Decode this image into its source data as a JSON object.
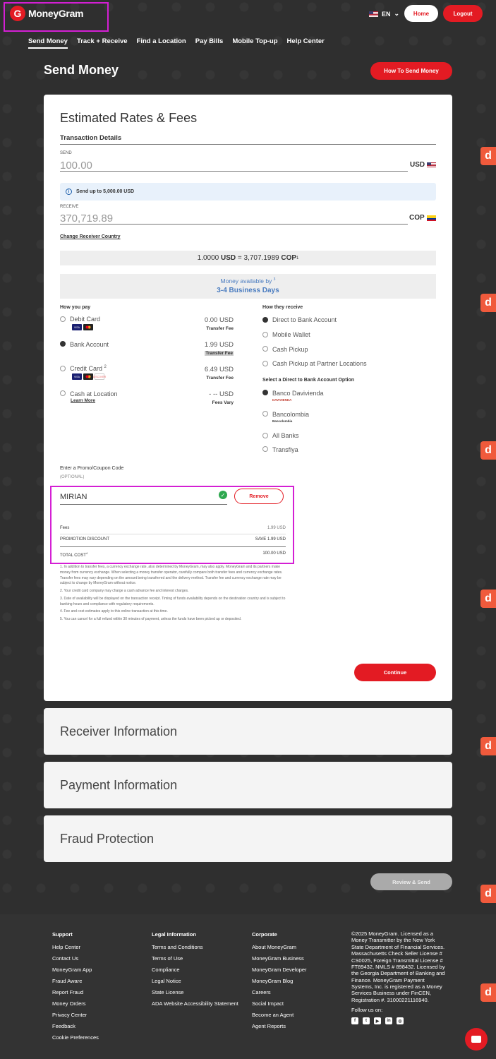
{
  "header": {
    "brand": "MoneyGram",
    "logo_glyph": "G",
    "language": "EN",
    "home_label": "Home",
    "logout_label": "Logout"
  },
  "nav": [
    "Send Money",
    "Track + Receive",
    "Find a Location",
    "Pay Bills",
    "Mobile Top-up",
    "Help Center"
  ],
  "page": {
    "title": "Send Money",
    "how_to_label": "How To Send Money"
  },
  "estimate": {
    "heading": "Estimated Rates & Fees",
    "section": "Transaction Details",
    "send_label": "SEND",
    "send_amount": "100.00",
    "send_currency": "USD",
    "send_limit": "Send up to 5,000.00 USD",
    "receive_label": "RECEIVE",
    "receive_amount": "370,719.89",
    "receive_currency": "COP",
    "change_country": "Change Receiver Country",
    "rate_left": "1.0000",
    "rate_left_cur": "USD",
    "rate_eq": "=",
    "rate_right": "3,707.1989",
    "rate_right_cur": "COP",
    "rate_sup": "1",
    "availability_label": "Money available by",
    "availability_sup": "3",
    "availability_value": "3-4 Business Days"
  },
  "pay": {
    "title": "How you pay",
    "options": [
      {
        "label": "Debit Card",
        "sup": "",
        "fee": "0.00 USD",
        "fee_label": "Transfer Fee"
      },
      {
        "label": "Bank Account",
        "sup": "",
        "fee": "1.99 USD",
        "fee_label": "Transfer Fee"
      },
      {
        "label": "Credit Card",
        "sup": "2",
        "fee": "6.49 USD",
        "fee_label": "Transfer Fee"
      },
      {
        "label": "Cash at Location",
        "sup": "",
        "fee": "- -- USD",
        "fee_label": "Fees Vary",
        "link": "Learn More"
      }
    ],
    "card_visa": "VISA",
    "card_discover": "DISCOVER",
    "selected": 1
  },
  "receive": {
    "title": "How they receive",
    "options": [
      "Direct to Bank Account",
      "Mobile Wallet",
      "Cash Pickup",
      "Cash Pickup at Partner Locations"
    ],
    "bank_title": "Select a Direct to Bank Account Option",
    "banks": [
      "Banco Davivienda",
      "Bancolombia",
      "All Banks",
      "Transfiya"
    ],
    "bank_logo_davivienda": "DAVIVIENDA",
    "bank_logo_bancolombia": "Bancolombia"
  },
  "promo": {
    "label": "Enter a Promo/Coupon Code",
    "optional": "(OPTIONAL)",
    "code": "MIRIAN",
    "remove_label": "Remove",
    "fees_label": "Fees",
    "fees_value": "1.99 USD",
    "discount_label": "PROMOTION DISCOUNT",
    "discount_value": "SAVE 1.99 USD",
    "total_label": "TOTAL COST",
    "total_sup": "4",
    "total_value": "100.00 USD"
  },
  "notes": [
    "1. In addition to transfer fees, a currency exchange rate, also determined by MoneyGram, may also apply. MoneyGram and its partners make money from currency exchange. When selecting a money transfer operator, carefully compare both transfer fees and currency exchange rates. Transfer fees may vary depending on the amount being transferred and the delivery method. Transfer fee and currency exchange rate may be subject to change by MoneyGram without notice.",
    "2. Your credit card company may charge a cash advance fee and interest charges.",
    "3. Date of availability will be displayed on the transaction receipt. Timing of funds availability depends on the destination country and is subject to banking hours and compliance with regulatory requirements.",
    "4. Fee and cost estimates apply to this online transaction at this time.",
    "5. You can cancel for a full refund within 30 minutes of payment, unless the funds have been picked up or deposited."
  ],
  "continue_label": "Continue",
  "panels": [
    "Receiver Information",
    "Payment Information",
    "Fraud Protection"
  ],
  "review_label": "Review & Send",
  "side_tab": "d",
  "footer": {
    "support": {
      "title": "Support",
      "items": [
        "Help Center",
        "Contact Us",
        "MoneyGram App",
        "Fraud Aware",
        "Report Fraud",
        "Money Orders",
        "Privacy Center",
        "Feedback",
        "Cookie Preferences"
      ]
    },
    "legal_info": {
      "title": "Legal Information",
      "items": [
        "Terms and Conditions",
        "Terms of Use",
        "Compliance",
        "Legal Notice",
        "State License",
        "ADA Website Accessibility Statement"
      ]
    },
    "corporate": {
      "title": "Corporate",
      "items": [
        "About MoneyGram",
        "MoneyGram Business",
        "MoneyGram Developer",
        "MoneyGram Blog",
        "Careers",
        "Social Impact",
        "Become an Agent",
        "Agent Reports"
      ]
    },
    "license_text": "©2025 MoneyGram. Licensed as a Money Transmitter by the New York State Department of Financial Services. Massachusetts Check Seller License # CS0025, Foreign Transmittal License # FT89432, NMLS # 898432. Licensed by the Georgia Department of Banking and Finance. MoneyGram Payment Systems, Inc. is registered as a Money Services Business under FinCEN, Registration #. 31000221116940.",
    "follow_label": "Follow us on:",
    "social_icons": [
      "facebook-icon",
      "twitter-icon",
      "youtube-icon",
      "linkedin-icon",
      "instagram-icon"
    ]
  },
  "colors": {
    "brand": "#e31b23",
    "highlight": "#d41fd4",
    "info_blue": "#4a7cc0"
  }
}
